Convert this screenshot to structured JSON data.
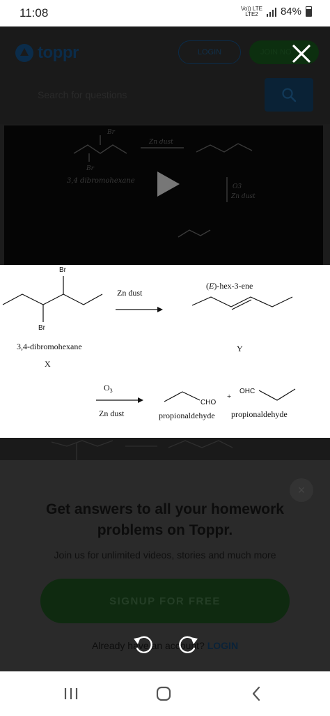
{
  "status_bar": {
    "time": "11:08",
    "network_top": "Vo)) LTE",
    "network_bottom": "LTE2",
    "battery": "84%"
  },
  "background_page": {
    "logo_text": "toppr",
    "login_label": "LOGIN",
    "join_label": "JOIN NO",
    "search_placeholder": "Search for questions",
    "video_caption": "3,4 dibromohexane"
  },
  "solution": {
    "reagent1": "Zn dust",
    "reactant_name": "3,4-dibromohexane",
    "reactant_label": "X",
    "product_name": "(E)-hex-3-ene",
    "product_label": "Y",
    "br_top": "Br",
    "br_bottom": "Br",
    "reagent2_top": "O",
    "reagent2_sub": "3",
    "reagent2_bottom": "Zn dust",
    "cho_label": "CHO",
    "ohc_label": "OHC",
    "plus": "+",
    "product2_name": "propionaldehyde",
    "product3_name": "propionaldehyde"
  },
  "signup_panel": {
    "close_symbol": "×",
    "heading": "Get answers to all your homework problems on Toppr.",
    "subtext": "Join us for unlimited videos, stories and much more",
    "signup_label": "SIGNUP FOR FREE",
    "already_text": "Already have an account?",
    "login_link": "LOGIN"
  },
  "icons": {
    "close": "close-icon",
    "search": "search-icon",
    "play": "play-icon",
    "rotate_left": "rotate-left-icon",
    "rotate_right": "rotate-right-icon",
    "recents": "recents-icon",
    "home": "home-icon",
    "back": "back-icon"
  }
}
